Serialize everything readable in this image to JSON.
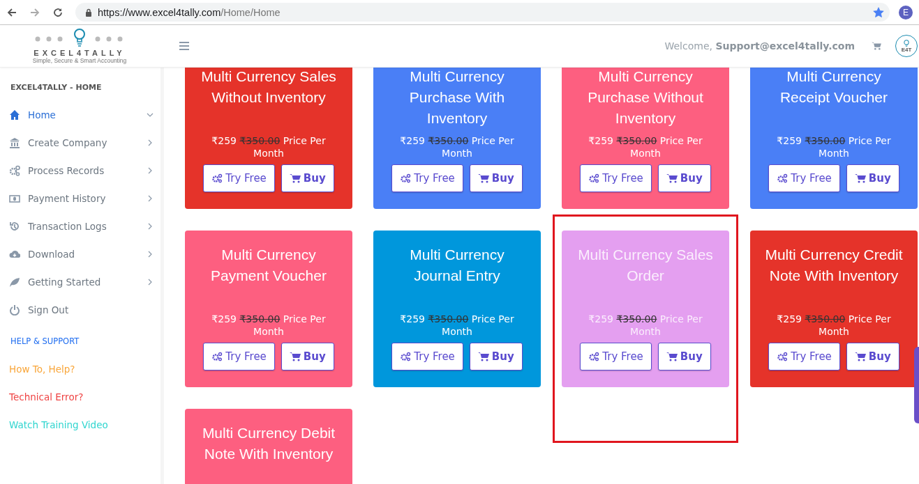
{
  "browser": {
    "url_host": "https://www.excel4tally.com",
    "url_path": "/Home/Home",
    "forward_disabled": true,
    "bookmarked": true,
    "profile_initial": "E"
  },
  "header": {
    "brand": "EXCEL4TALLY",
    "tagline": "Simple, Secure & Smart Accounting",
    "welcome": "Welcome, **Support@excel4tally.com**",
    "badge": "E4T"
  },
  "sidebar": {
    "heading": "EXCEL4TALLY - HOME",
    "items": [
      {
        "label": "Home",
        "selected": true,
        "expandable": true,
        "expanded": true
      },
      {
        "label": "Create Company",
        "selected": false,
        "expandable": true,
        "expanded": false
      },
      {
        "label": "Process Records",
        "selected": false,
        "expandable": true,
        "expanded": false
      },
      {
        "label": "Payment History",
        "selected": false,
        "expandable": true,
        "expanded": false
      },
      {
        "label": "Transaction Logs",
        "selected": false,
        "expandable": true,
        "expanded": false
      },
      {
        "label": "Download",
        "selected": false,
        "expandable": true,
        "expanded": false
      },
      {
        "label": "Getting Started",
        "selected": false,
        "expandable": true,
        "expanded": false
      },
      {
        "label": "Sign Out",
        "selected": false,
        "expandable": false,
        "expanded": false
      }
    ],
    "support_heading": "HELP & SUPPORT",
    "links": [
      {
        "label": "How To, Help?",
        "color": "#f9a63a"
      },
      {
        "label": "Technical Error?",
        "color": "#ef4343"
      },
      {
        "label": "Watch Training Video",
        "color": "#2fd5cf"
      }
    ]
  },
  "cards": [
    {
      "title": "Multi Currency Sales Without Inventory",
      "price": "₹259",
      "old_price": "₹350.00",
      "period": "Price Per Month",
      "color": "#e5332a",
      "highlighted": false,
      "try": "Try Free",
      "buy": "Buy"
    },
    {
      "title": "Multi Currency Purchase With Inventory",
      "price": "₹259",
      "old_price": "₹350.00",
      "period": "Price Per Month",
      "color": "#4a7ff6",
      "highlighted": false,
      "try": "Try Free",
      "buy": "Buy"
    },
    {
      "title": "Multi Currency Purchase Without Inventory",
      "price": "₹259",
      "old_price": "₹350.00",
      "period": "Price Per Month",
      "color": "#fd5f80",
      "highlighted": false,
      "try": "Try Free",
      "buy": "Buy"
    },
    {
      "title": "Multi Currency Receipt Voucher",
      "price": "₹259",
      "old_price": "₹350.00",
      "period": "Price Per Month",
      "color": "#4a7ff6",
      "highlighted": false,
      "try": "Try Free",
      "buy": "Buy"
    },
    {
      "title": "Multi Currency Payment Voucher",
      "price": "₹259",
      "old_price": "₹350.00",
      "period": "Price Per Month",
      "color": "#fd5f80",
      "highlighted": false,
      "try": "Try Free",
      "buy": "Buy"
    },
    {
      "title": "Multi Currency Journal Entry",
      "price": "₹259",
      "old_price": "₹350.00",
      "period": "Price Per Month",
      "color": "#0097dc",
      "highlighted": false,
      "try": "Try Free",
      "buy": "Buy"
    },
    {
      "title": "Multi Currency Sales Order",
      "price": "₹259",
      "old_price": "₹350.00",
      "period": "Price Per Month",
      "color": "#e49ff0",
      "highlighted": true,
      "try": "Try Free",
      "buy": "Buy"
    },
    {
      "title": "Multi Currency Credit Note With Inventory",
      "price": "₹259",
      "old_price": "₹350.00",
      "period": "Price Per Month",
      "color": "#e5332a",
      "highlighted": false,
      "try": "Try Free",
      "buy": "Buy"
    },
    {
      "title": "Multi Currency Debit Note With Inventory",
      "color": "#fd5f80",
      "highlighted": false
    }
  ]
}
